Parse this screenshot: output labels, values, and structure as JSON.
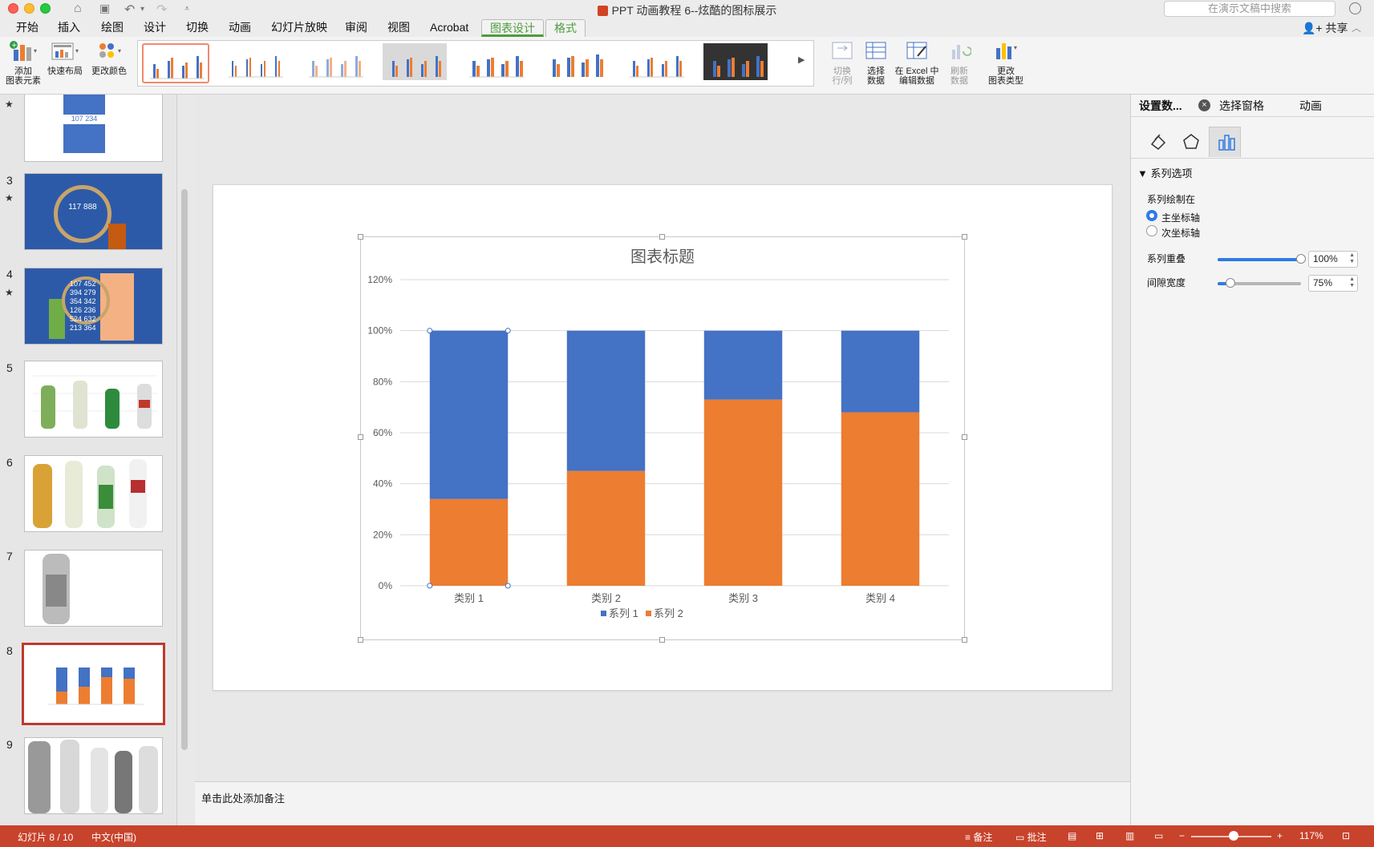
{
  "window": {
    "title": "PPT 动画教程 6--炫酷的图标展示",
    "search_placeholder": "在演示文稿中搜索"
  },
  "ribbon_tabs": [
    "开始",
    "插入",
    "绘图",
    "设计",
    "切换",
    "动画",
    "幻灯片放映",
    "审阅",
    "视图",
    "Acrobat",
    "图表设计",
    "格式"
  ],
  "active_tab": "图表设计",
  "share_label": "共享",
  "ribbon": {
    "add_element": [
      "添加",
      "图表元素"
    ],
    "quick_layout": "快速布局",
    "change_color": "更改颜色",
    "switch_rowcol": [
      "切换",
      "行/列"
    ],
    "select_data": [
      "选择",
      "数据"
    ],
    "edit_in_excel": [
      "在 Excel 中",
      "编辑数据"
    ],
    "refresh_data": [
      "刷新",
      "数据"
    ],
    "change_type": [
      "更改",
      "图表类型"
    ]
  },
  "slides": [
    {
      "num": "",
      "star": true,
      "label": "107 234"
    },
    {
      "num": "3",
      "star": true,
      "label": "117 888"
    },
    {
      "num": "4",
      "star": true,
      "label": "107 452"
    },
    {
      "num": "5",
      "star": false,
      "label": ""
    },
    {
      "num": "6",
      "star": false,
      "label": ""
    },
    {
      "num": "7",
      "star": false,
      "label": ""
    },
    {
      "num": "8",
      "star": false,
      "label": ""
    },
    {
      "num": "9",
      "star": false,
      "label": ""
    }
  ],
  "slide4_values": [
    "107 452",
    "394 279",
    "354 342",
    "126 236",
    "524 632",
    "213 364"
  ],
  "notes_placeholder": "单击此处添加备注",
  "chart_data": {
    "type": "bar",
    "stacked": "percent",
    "title": "图表标题",
    "categories": [
      "类别 1",
      "类别 2",
      "类别 3",
      "类别 4"
    ],
    "series": [
      {
        "name": "系列 2",
        "color": "#ed7d31",
        "values": [
          34,
          45,
          73,
          68
        ]
      },
      {
        "name": "系列 1",
        "color": "#4472c4",
        "values": [
          66,
          55,
          27,
          32
        ]
      }
    ],
    "legend_order": [
      "系列 1",
      "系列 2"
    ],
    "ylim": [
      0,
      120
    ],
    "yticks": [
      "0%",
      "20%",
      "40%",
      "60%",
      "80%",
      "100%",
      "120%"
    ],
    "grid": true,
    "legend": "bottom"
  },
  "format_pane": {
    "tabs": [
      "设置数...",
      "选择窗格",
      "动画"
    ],
    "section": "系列选项",
    "plot_on_label": "系列绘制在",
    "primary_axis": "主坐标轴",
    "secondary_axis": "次坐标轴",
    "overlap_label": "系列重叠",
    "overlap_value": "100%",
    "overlap_fraction": 1.0,
    "gap_label": "间隙宽度",
    "gap_value": "75%",
    "gap_fraction": 0.15
  },
  "status": {
    "slide_info": "幻灯片 8 / 10",
    "language": "中文(中国)",
    "notes": "备注",
    "comments": "批注",
    "zoom": "117%"
  },
  "colors": {
    "accent_green": "#4d9c3c",
    "status_bar": "#c8432c",
    "series_blue": "#4472c4",
    "series_orange": "#ed7d31"
  }
}
